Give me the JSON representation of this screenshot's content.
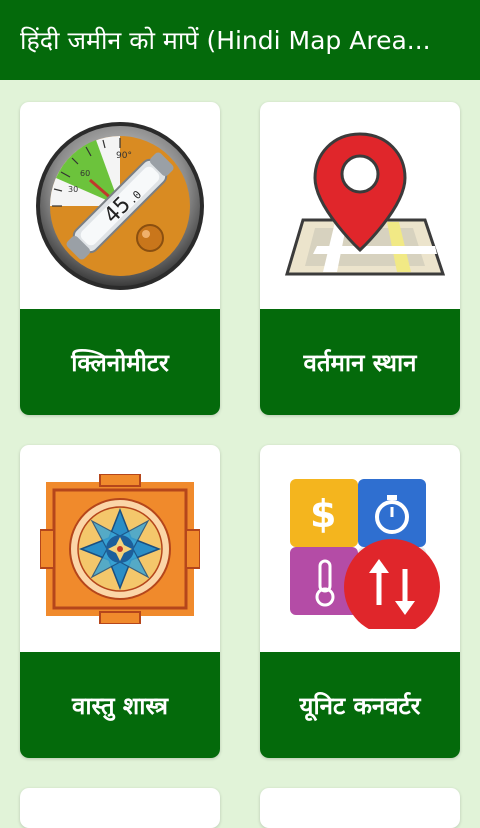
{
  "app_bar": {
    "title": "हिंदी जमीन को मापें (Hindi Map Area..."
  },
  "cards": [
    {
      "label": "क्लिनोमीटर",
      "icon": "clinometer-icon"
    },
    {
      "label": "वर्तमान स्थान",
      "icon": "location-pin-map-icon"
    },
    {
      "label": "वास्तु शास्त्र",
      "icon": "vastu-yantra-icon"
    },
    {
      "label": "यूनिट कनवर्टर",
      "icon": "unit-converter-icon"
    }
  ],
  "clinometer": {
    "reading": "45",
    "reading_decimal": ".0",
    "top_scale": "90°",
    "left_scale_a": "30",
    "left_scale_b": "60"
  },
  "colors": {
    "primary": "#046a0b",
    "background": "#e1f3d8",
    "card": "#ffffff",
    "pin": "#e0262b"
  }
}
